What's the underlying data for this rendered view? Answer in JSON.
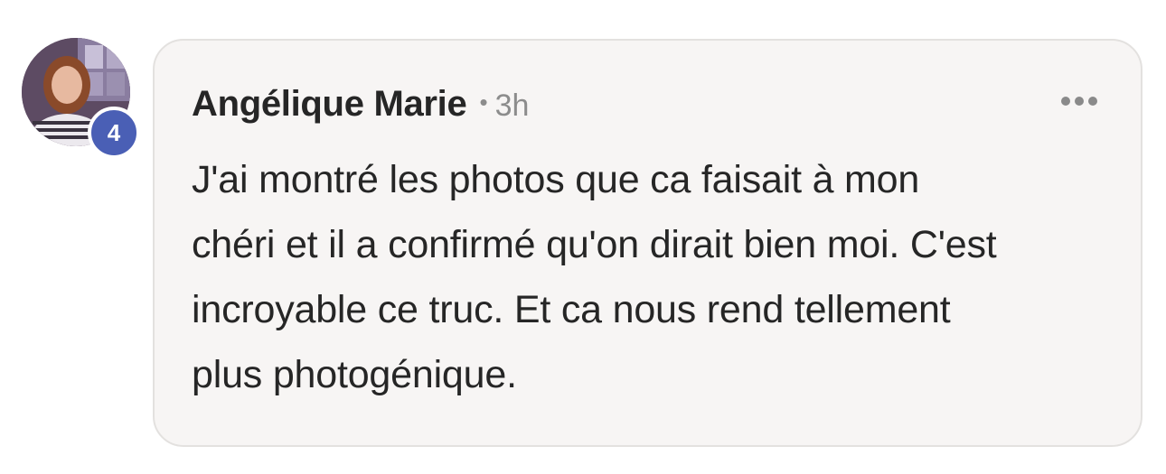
{
  "comment": {
    "author": "Angélique Marie",
    "separator": "•",
    "time": "3h",
    "badge_count": "4",
    "avatar_icon": "profile-photo",
    "more_icon": "more-options-icon",
    "text_lines": [
      "J'ai montré les photos que ca faisait à mon",
      "chéri et il a confirmé qu'on dirait bien moi. C'est",
      "incroyable ce truc. Et ca nous rend tellement",
      "plus photogénique."
    ]
  },
  "colors": {
    "bubble_background": "#f7f5f4",
    "bubble_border": "#e3e1df",
    "badge": "#4a5fb5",
    "text": "#262626",
    "meta": "#8c8c8c"
  }
}
